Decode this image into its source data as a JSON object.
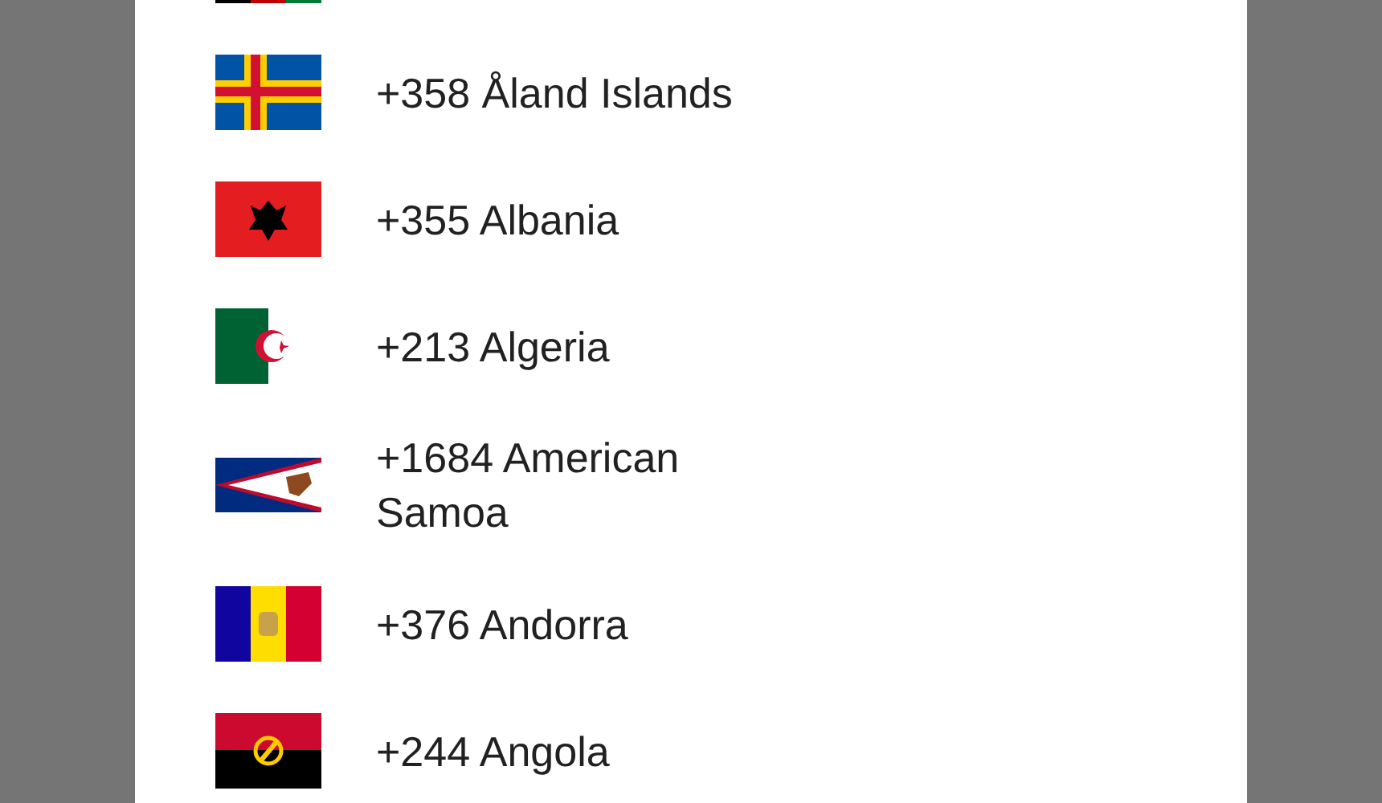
{
  "country_list": [
    {
      "kind": "afghanistan"
    },
    {
      "kind": "aland",
      "label": "+358 Åland Islands"
    },
    {
      "kind": "albania",
      "label": "+355 Albania"
    },
    {
      "kind": "algeria",
      "label": "+213 Algeria"
    },
    {
      "kind": "american_samoa",
      "label": "+1684 American Samoa"
    },
    {
      "kind": "andorra",
      "label": "+376 Andorra"
    },
    {
      "kind": "angola",
      "label": "+244 Angola"
    }
  ]
}
